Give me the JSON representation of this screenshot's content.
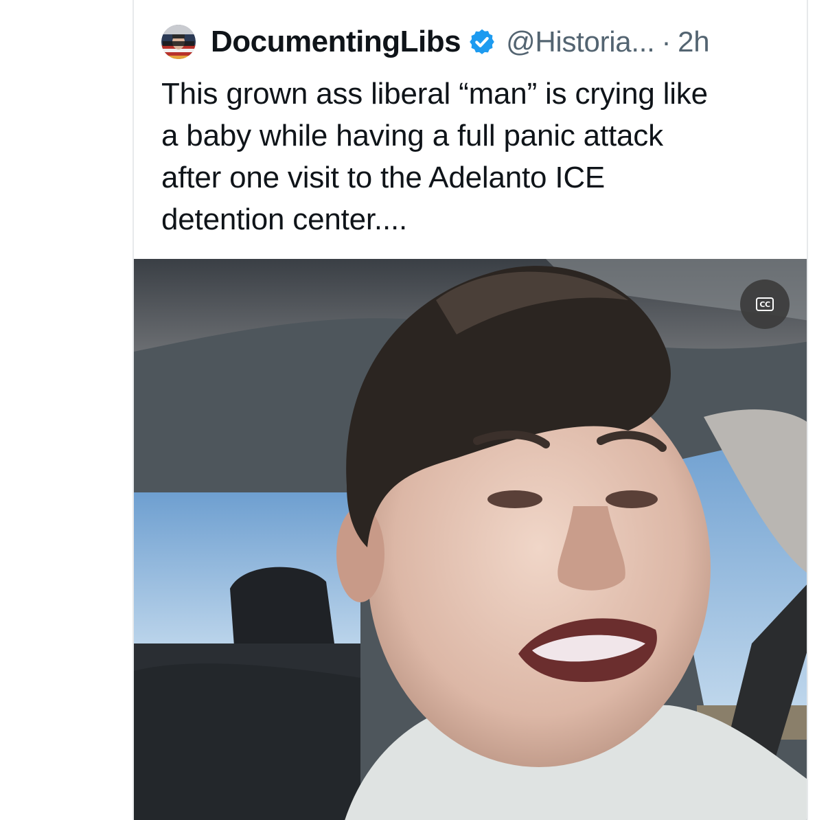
{
  "tweet": {
    "display_name": "DocumentingLibs",
    "handle": "@Historia...",
    "separator": "·",
    "time": "2h",
    "verified_icon": "verified-badge-icon",
    "avatar_icon": "profile-avatar",
    "text": "This grown ass liberal “man” is crying like\na baby while having a full panic attack\nafter one visit to the Adelanto ICE\ndetention center...."
  },
  "media": {
    "type": "video",
    "captions_label": "CC",
    "captions_icon": "closed-captions-icon"
  },
  "colors": {
    "text_primary": "#0f1419",
    "text_secondary": "#536471",
    "verified_blue": "#1d9bf0",
    "card_border": "#e7e9eb"
  }
}
